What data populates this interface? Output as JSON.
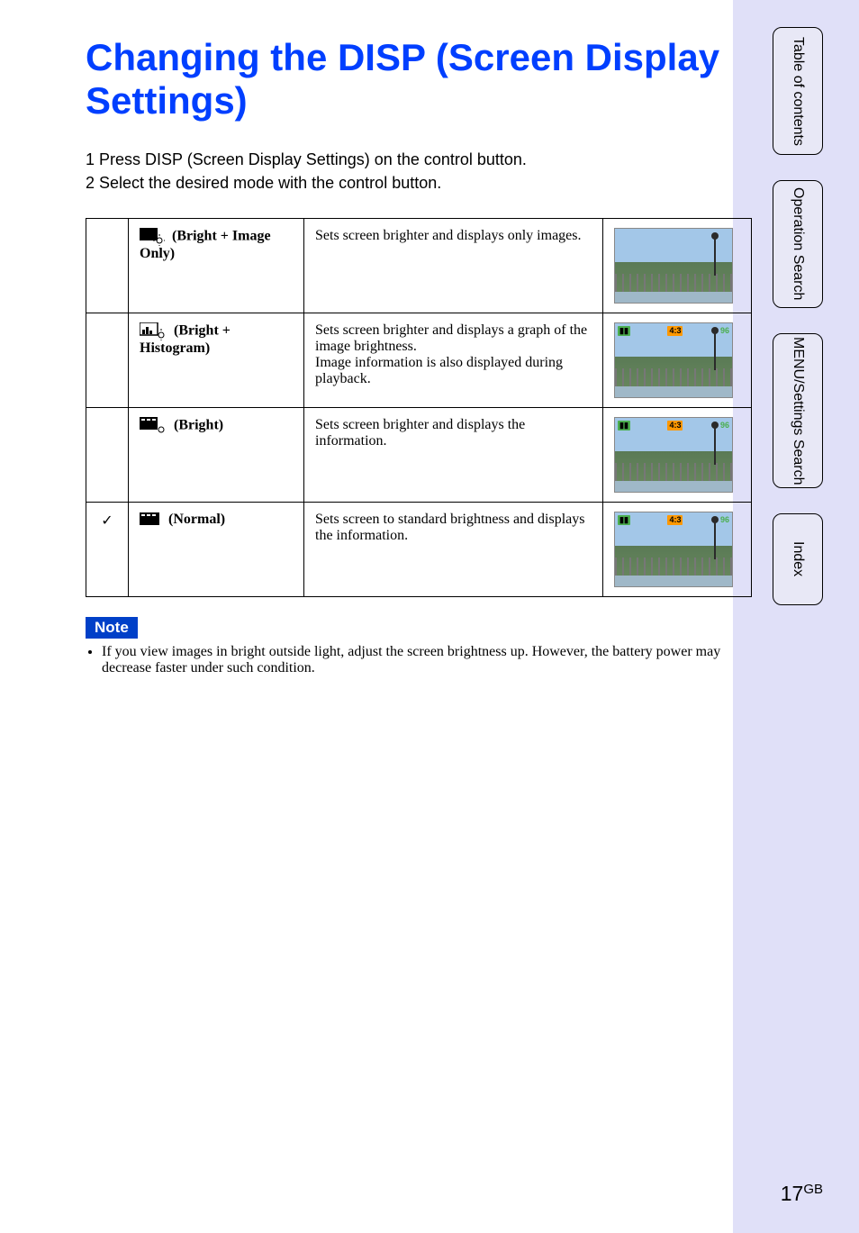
{
  "title": "Changing the DISP (Screen Display Settings)",
  "steps": [
    "1  Press DISP (Screen Display Settings) on the control button.",
    "2  Select the desired mode with the control button."
  ],
  "modes": [
    {
      "checked": false,
      "label": "(Bright + Image Only)",
      "desc": "Sets screen brighter and displays only images.",
      "osd": false
    },
    {
      "checked": false,
      "label": "(Bright + Histogram)",
      "desc": "Sets screen brighter and displays a graph of the image brightness.\nImage information is also displayed during playback.",
      "osd": true
    },
    {
      "checked": false,
      "label": "(Bright)",
      "desc": "Sets screen brighter and displays the information.",
      "osd": true
    },
    {
      "checked": true,
      "label": "(Normal)",
      "desc": "Sets screen to standard brightness and displays the information.",
      "osd": true
    }
  ],
  "note_label": "Note",
  "note_text": "If you view images in bright outside light, adjust the screen brightness up. However, the battery power may decrease faster under such condition.",
  "osd_values": {
    "batt": "",
    "size": "",
    "count": "96"
  },
  "tabs": [
    {
      "key": "toc",
      "label": "Table of contents"
    },
    {
      "key": "op",
      "label": "Operation Search"
    },
    {
      "key": "menu",
      "label": "MENU/Settings Search"
    },
    {
      "key": "index",
      "label": "Index"
    }
  ],
  "page_number": "17",
  "page_region": "GB",
  "checkmark": "✓"
}
